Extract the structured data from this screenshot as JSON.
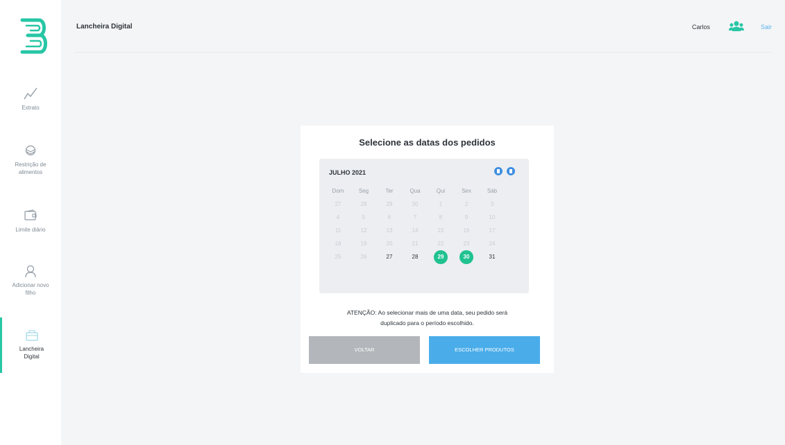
{
  "sidebar": {
    "items": [
      {
        "label_lines": [
          "Extrato"
        ],
        "icon": "chart-line-icon"
      },
      {
        "label_lines": [
          "Restrição de",
          "alimentos"
        ],
        "icon": "layers-icon"
      },
      {
        "label_lines": [
          "Limite diário"
        ],
        "icon": "wallet-icon"
      },
      {
        "label_lines": [
          "Adicionar novo",
          "filho"
        ],
        "icon": "user-add-icon"
      },
      {
        "label_lines": [
          "Lancheira",
          "Digital"
        ],
        "icon": "lunchbox-icon",
        "active": true
      }
    ]
  },
  "header": {
    "title": "Lancheira Digital",
    "user_name": "Carlos",
    "exit_label": "Sair"
  },
  "modal": {
    "title": "Selecione as datas dos pedidos",
    "warning_line1": "ATENÇÃO: Ao selecionar mais de uma data, seu pedido será",
    "warning_line2": "duplicado para o período escolhido.",
    "back_label": "VOLTAR",
    "choose_label": "ESCOLHER PRODUTOS"
  },
  "calendar": {
    "month": "JULHO 2021",
    "weekdays": [
      "Dom",
      "Seg",
      "Ter",
      "Qua",
      "Qui",
      "Sex",
      "Sáb"
    ],
    "weeks": [
      [
        "27",
        "28",
        "29",
        "30",
        "1",
        "2",
        "3"
      ],
      [
        "4",
        "5",
        "6",
        "7",
        "8",
        "9",
        "10"
      ],
      [
        "11",
        "12",
        "13",
        "14",
        "15",
        "16",
        "17"
      ],
      [
        "18",
        "19",
        "20",
        "21",
        "22",
        "23",
        "24"
      ],
      [
        "25",
        "26",
        "27",
        "28",
        "29",
        "30",
        "31"
      ]
    ],
    "available": [
      "27",
      "28",
      "31"
    ],
    "selected": [
      "29",
      "30"
    ]
  },
  "colors": {
    "accent": "#27c6a5",
    "selected_day": "#20c290",
    "primary_button": "#4aadea",
    "disabled_button": "#b3b6ba",
    "link": "#5bb3ea"
  }
}
